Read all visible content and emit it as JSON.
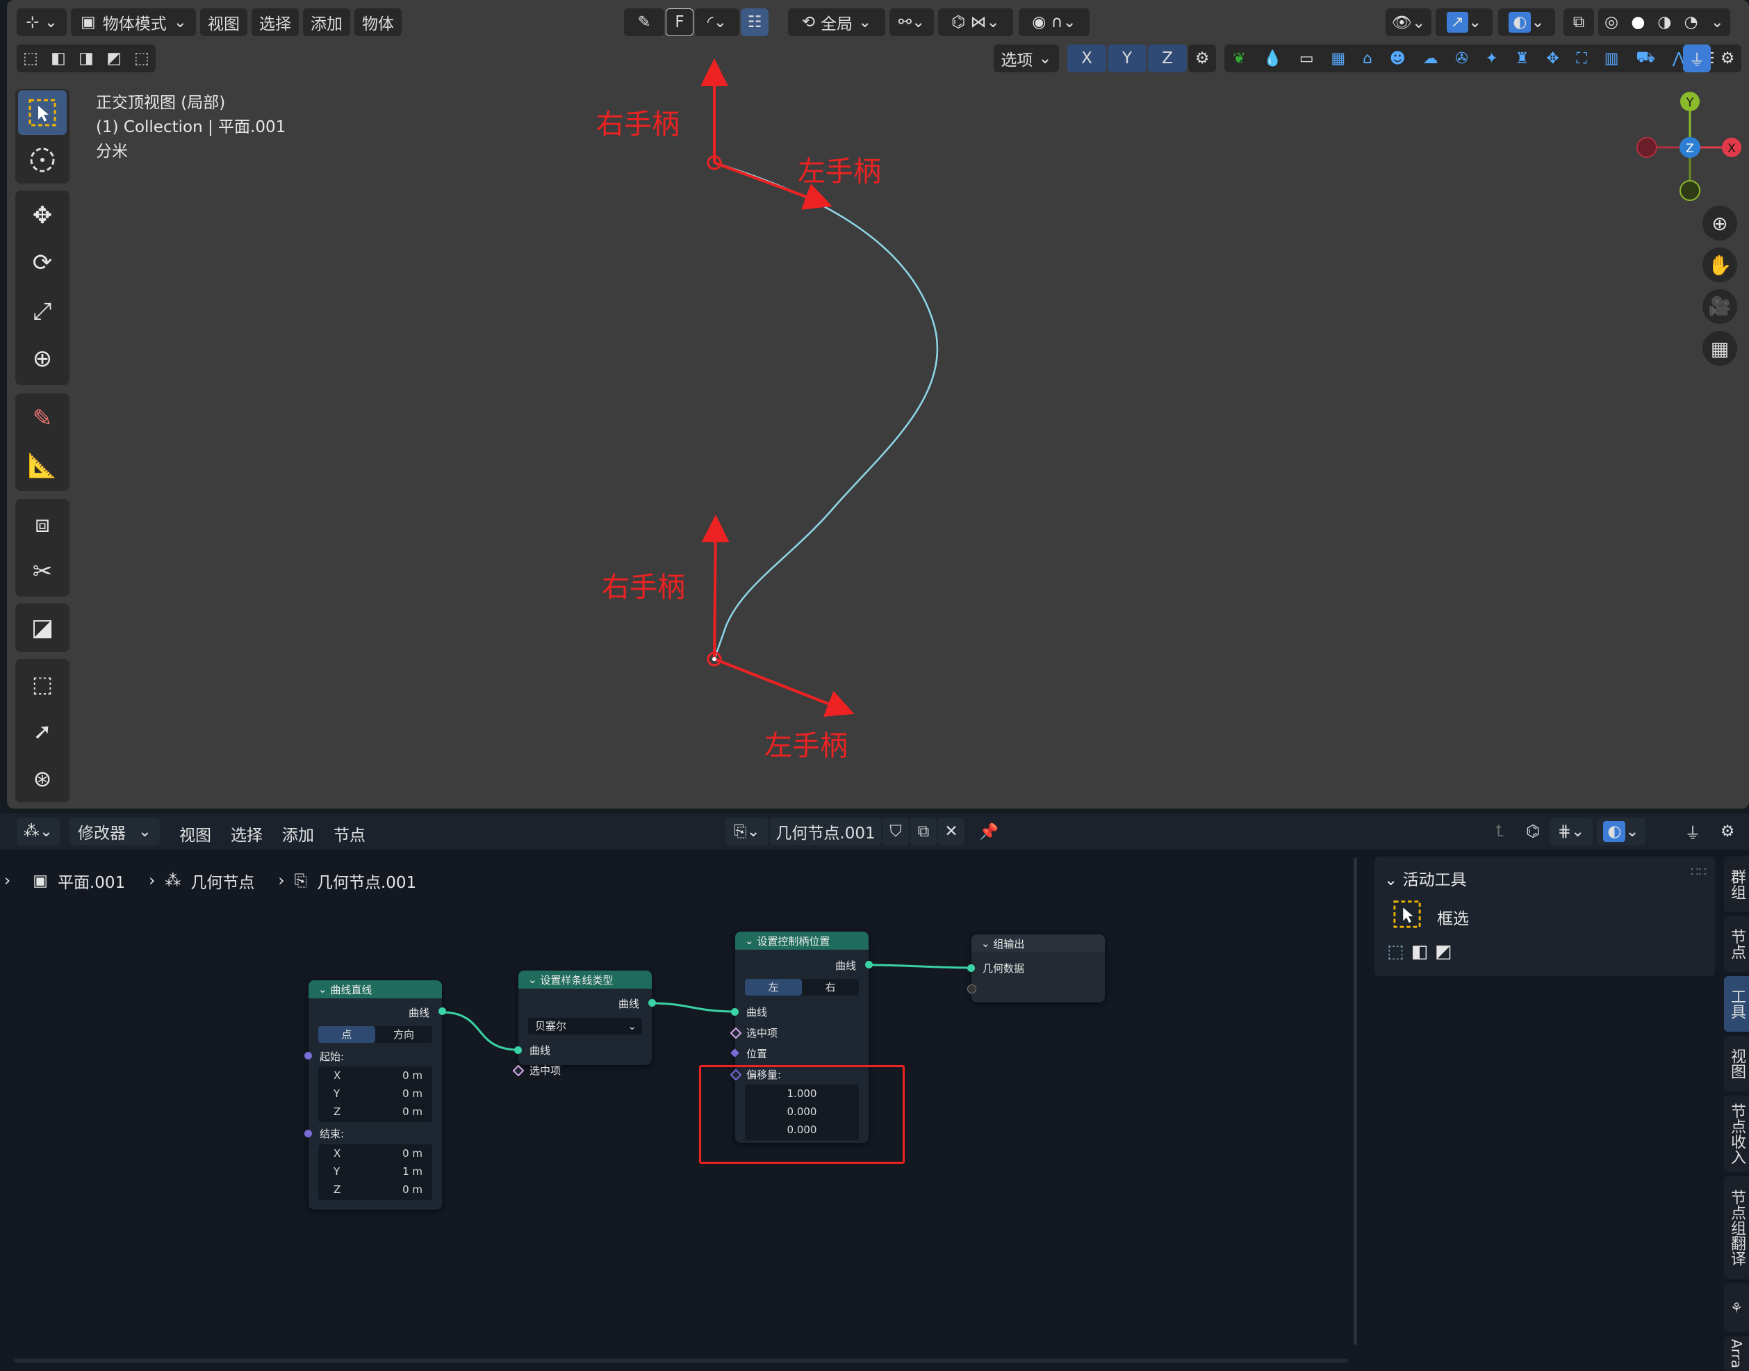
{
  "top_header": {
    "mode": "物体模式",
    "menus": [
      "视图",
      "选择",
      "添加",
      "物体"
    ],
    "snap_mode": "全局",
    "options": "选项",
    "axes": [
      "X",
      "Y",
      "Z"
    ]
  },
  "viewport": {
    "view_name": "正交顶视图 (局部)",
    "collection": "(1) Collection | 平面.001",
    "unit": "分米",
    "gizmo": {
      "x": "X",
      "y": "Y",
      "z": "Z"
    },
    "annotations": {
      "top_right_handle": "右手柄",
      "top_left_handle": "左手柄",
      "bottom_right_handle": "右手柄",
      "bottom_left_handle": "左手柄"
    }
  },
  "node_header": {
    "editor": "修改器",
    "menus": [
      "视图",
      "选择",
      "添加",
      "节点"
    ],
    "node_tree": "几何节点.001"
  },
  "breadcrumb": [
    "平面.001",
    "几何节点",
    "几何节点.001"
  ],
  "nodes": {
    "curve_line": {
      "title": "曲线直线",
      "output": "曲线",
      "mode_tabs": [
        "点",
        "方向"
      ],
      "start_label": "起始:",
      "start": [
        {
          "axis": "X",
          "value": "0 m"
        },
        {
          "axis": "Y",
          "value": "0 m"
        },
        {
          "axis": "Z",
          "value": "0 m"
        }
      ],
      "end_label": "结束:",
      "end": [
        {
          "axis": "X",
          "value": "0 m"
        },
        {
          "axis": "Y",
          "value": "1 m"
        },
        {
          "axis": "Z",
          "value": "0 m"
        }
      ]
    },
    "set_spline_type": {
      "title": "设置样条线类型",
      "output": "曲线",
      "type": "贝塞尔",
      "input_curve": "曲线",
      "input_selection": "选中项"
    },
    "set_handle_positions": {
      "title": "设置控制柄位置",
      "output": "曲线",
      "side_tabs": [
        "左",
        "右"
      ],
      "input_curve": "曲线",
      "input_selection": "选中项",
      "input_position": "位置",
      "offset_label": "偏移量:",
      "offset": [
        "1.000",
        "0.000",
        "0.000"
      ]
    },
    "group_output": {
      "title": "组输出",
      "input_geometry": "几何数据"
    }
  },
  "sidebar": {
    "panel_title": "活动工具",
    "tool_name": "框选",
    "tabs": [
      "群组",
      "节点",
      "工具",
      "视图",
      "节点收入",
      "节点组翻译",
      "Arra"
    ]
  },
  "colors": {
    "curve": "#8fd8ea",
    "annotation": "#ee2222",
    "node_header_green": "#1f6b5c",
    "socket_green": "#3ad3a5",
    "socket_purple": "#7a6dd8",
    "accent_blue": "#3d7dd8"
  }
}
